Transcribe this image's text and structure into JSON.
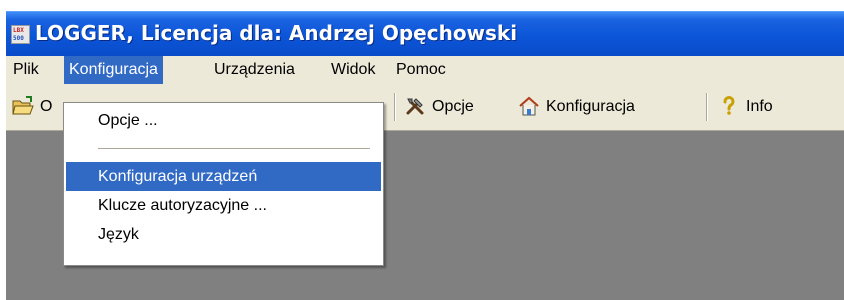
{
  "window": {
    "title": "LOGGER, Licencja dla: Andrzej Opęchowski",
    "icon_top": "LBX",
    "icon_bottom": "500"
  },
  "menubar": {
    "items": [
      {
        "label": "Plik"
      },
      {
        "label": "Konfiguracja",
        "active": true
      },
      {
        "label": "Urządzenia"
      },
      {
        "label": "Widok"
      },
      {
        "label": "Pomoc"
      }
    ]
  },
  "toolbar": {
    "open_label_partial": "O",
    "options_label": "Opcje",
    "config_label": "Konfiguracja",
    "info_label": "Info"
  },
  "dropdown": {
    "items": [
      {
        "label": "Opcje ..."
      },
      {
        "label": "Konfiguracja urządzeń",
        "highlighted": true
      },
      {
        "label": "Klucze autoryzacyjne ..."
      },
      {
        "label": "Język"
      }
    ]
  },
  "colors": {
    "titlebar": "#0b55d8",
    "menu_highlight": "#316ac5",
    "face": "#ece9d8",
    "client": "#808080"
  }
}
